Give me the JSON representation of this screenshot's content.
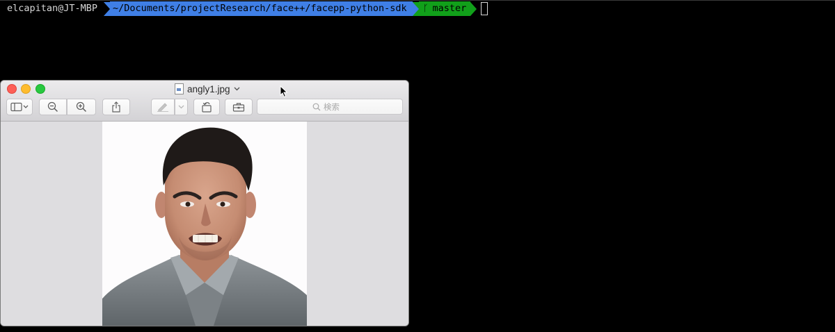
{
  "terminal": {
    "user_host": "elcapitan@JT-MBP",
    "path": "~/Documents/projectResearch/face++/facepp-python-sdk",
    "branch_icon": "git-branch-icon",
    "branch_symbol": "ᚴ",
    "branch": "master",
    "colors": {
      "background": "#000000",
      "path_segment": "#3f7fe6",
      "git_segment": "#11a01a"
    }
  },
  "preview": {
    "app": "Preview",
    "title": "angly1.jpg",
    "toolbar": {
      "sidebar_icon": "sidebar-toggle-icon",
      "zoom_out_icon": "zoom-out-icon",
      "zoom_in_icon": "zoom-in-icon",
      "share_icon": "share-icon",
      "markup_icon": "markup-pen-icon",
      "rotate_icon": "rotate-left-icon",
      "toolbox_icon": "toolbox-icon",
      "search_icon": "search-icon",
      "search_placeholder": "検索"
    },
    "image": {
      "subject": "photo-of-angry-man",
      "background": "#fdfcfd"
    }
  }
}
